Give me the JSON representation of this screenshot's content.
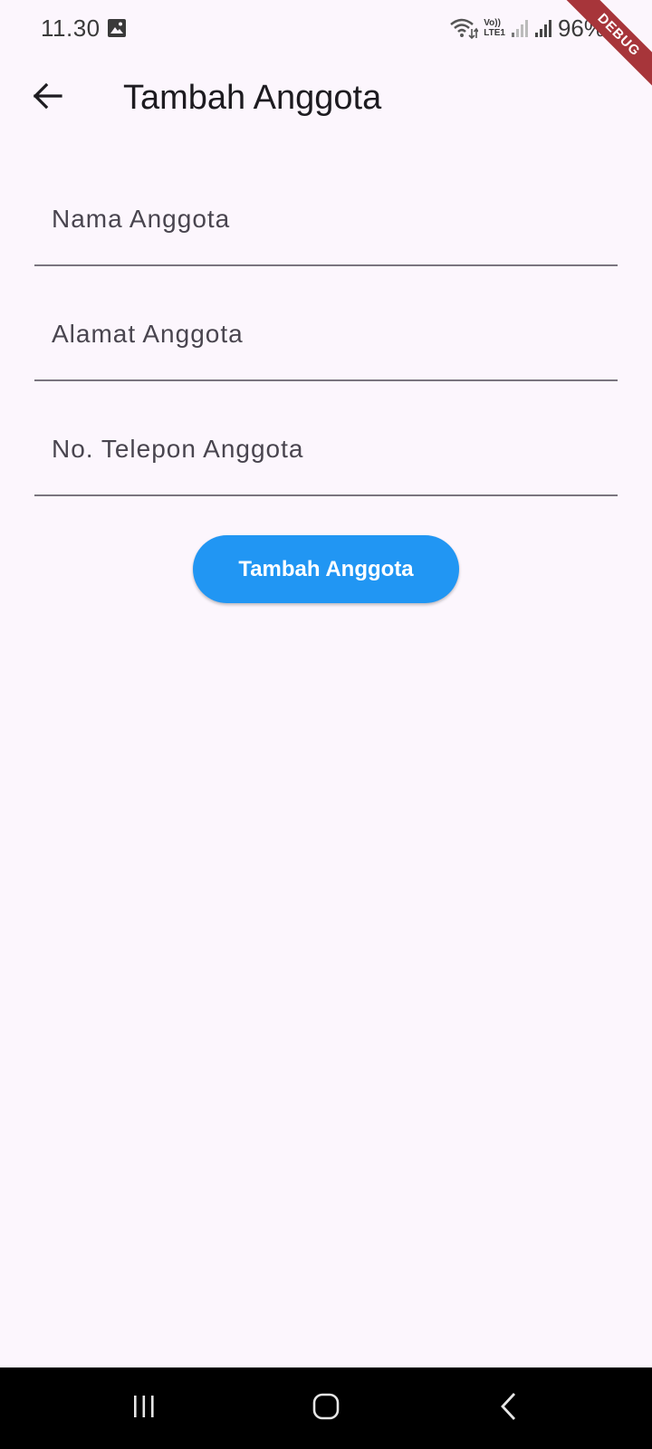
{
  "status_bar": {
    "time": "11.30",
    "battery": "96%",
    "lte_top": "Vo))",
    "lte_bottom": "LTE1",
    "icons": [
      "gallery-icon",
      "wifi-icon",
      "volte-icon",
      "signal-weak-icon",
      "signal-icon",
      "battery-charging-icon"
    ]
  },
  "debug_banner": {
    "label": "DEBUG",
    "color": "#a7353a"
  },
  "app_bar": {
    "back_icon": "arrow-back-icon",
    "title": "Tambah Anggota"
  },
  "form": {
    "fields": [
      {
        "placeholder": "Nama Anggota",
        "value": ""
      },
      {
        "placeholder": "Alamat Anggota",
        "value": ""
      },
      {
        "placeholder": "No. Telepon Anggota",
        "value": ""
      }
    ],
    "submit_label": "Tambah Anggota",
    "accent_color": "#2196f3"
  },
  "nav_bar": {
    "icons": [
      "recents-icon",
      "home-icon",
      "back-icon"
    ]
  },
  "colors": {
    "background": "#fcf6fd",
    "text_primary": "#1d1b20",
    "text_hint": "#49454f",
    "underline": "#7a757f"
  }
}
